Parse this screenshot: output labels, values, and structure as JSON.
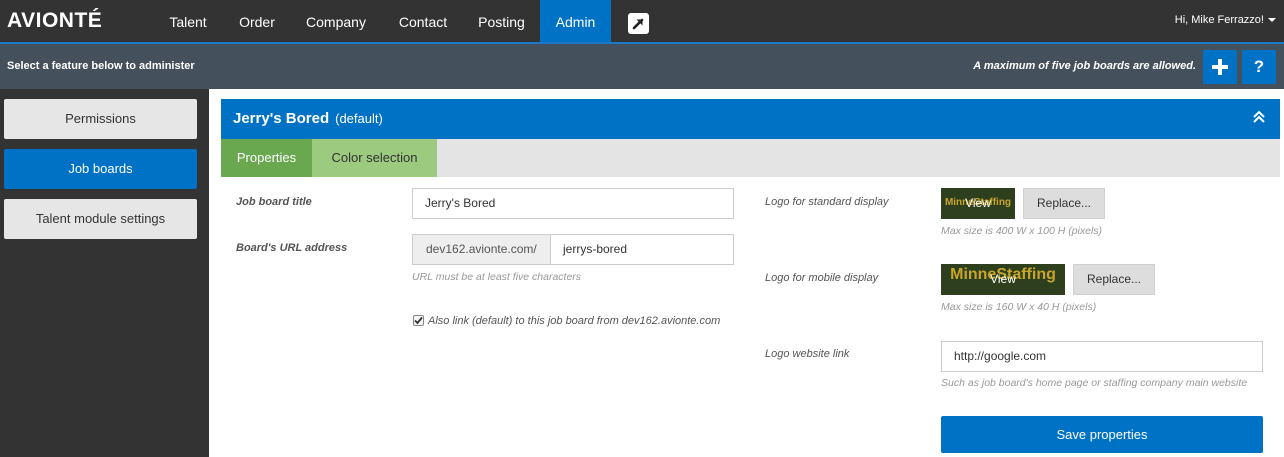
{
  "brand": {
    "logo_text": "AVIONTÉ"
  },
  "nav": {
    "items": [
      {
        "label": "Talent"
      },
      {
        "label": "Order"
      },
      {
        "label": "Company"
      },
      {
        "label": "Contact"
      },
      {
        "label": "Posting"
      },
      {
        "label": "Admin",
        "active": true
      }
    ],
    "user_greeting": "Hi, Mike Ferrazzo!"
  },
  "subheader": {
    "instruction": "Select a feature below to administer",
    "notice": "A maximum of five job boards are allowed.",
    "add_label": "+",
    "help_label": "?"
  },
  "sidebar": {
    "items": [
      {
        "label": "Permissions"
      },
      {
        "label": "Job boards",
        "active": true
      },
      {
        "label": "Talent module settings"
      }
    ]
  },
  "panel": {
    "title": "Jerry's Bored",
    "default_tag": "(default)",
    "tabs": [
      {
        "label": "Properties",
        "active": true
      },
      {
        "label": "Color selection"
      }
    ]
  },
  "form": {
    "title_label": "Job board title",
    "title_value": "Jerry's Bored",
    "url_label": "Board's URL address",
    "url_prefix": "dev162.avionte.com/",
    "url_value": "jerrys-bored",
    "url_hint": "URL must be at least five characters",
    "also_link_label": "Also link (default) to this job board from dev162.avionte.com",
    "also_link_checked": true,
    "logo_std_label": "Logo for standard display",
    "logo_std_view": "View",
    "logo_std_brand": "MinneStaffing",
    "logo_std_replace": "Replace...",
    "logo_std_hint": "Max size is 400 W x 100 H (pixels)",
    "logo_mobile_label": "Logo for mobile display",
    "logo_mobile_view": "View",
    "logo_mobile_brand": "MinneStaffing",
    "logo_mobile_replace": "Replace...",
    "logo_mobile_hint": "Max size is 160 W x 40 H (pixels)",
    "logo_link_label": "Logo website link",
    "logo_link_value": "http://google.com",
    "logo_link_hint": "Such as job board's home page or staffing company main website",
    "save_label": "Save properties"
  },
  "colors": {
    "nav_bg": "#333333",
    "accent_blue": "#0072c6",
    "subheader_bg": "#44515c",
    "tab_active_green": "#6aa84f",
    "tab_inactive_green": "#9ccb80"
  },
  "icons": {
    "external_link": "external-link-icon",
    "collapse": "chevron-double-up-icon",
    "user_menu": "caret-down-icon"
  }
}
